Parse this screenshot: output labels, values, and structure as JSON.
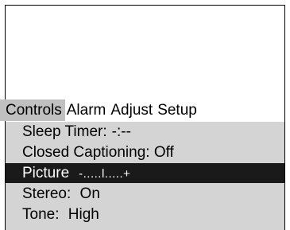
{
  "tabs": [
    {
      "label": "Controls",
      "active": true
    },
    {
      "label": "Alarm",
      "active": false
    },
    {
      "label": "Adjust",
      "active": false
    },
    {
      "label": "Setup",
      "active": false
    }
  ],
  "menu": {
    "sleep_timer": {
      "label": "Sleep Timer:",
      "value": "-:--"
    },
    "closed_captioning": {
      "label": "Closed Captioning:",
      "value": "Off"
    },
    "picture": {
      "label": "Picture",
      "value": "-.....l.....+"
    },
    "stereo": {
      "label": "Stereo:",
      "value": "On"
    },
    "tone": {
      "label": "Tone:",
      "value": "High"
    }
  },
  "colors": {
    "tab_highlight": "#c0c0c0",
    "menu_bg": "#d4d4d4",
    "selected_bg": "#1a1a1a",
    "selected_fg": "#ffffff"
  }
}
